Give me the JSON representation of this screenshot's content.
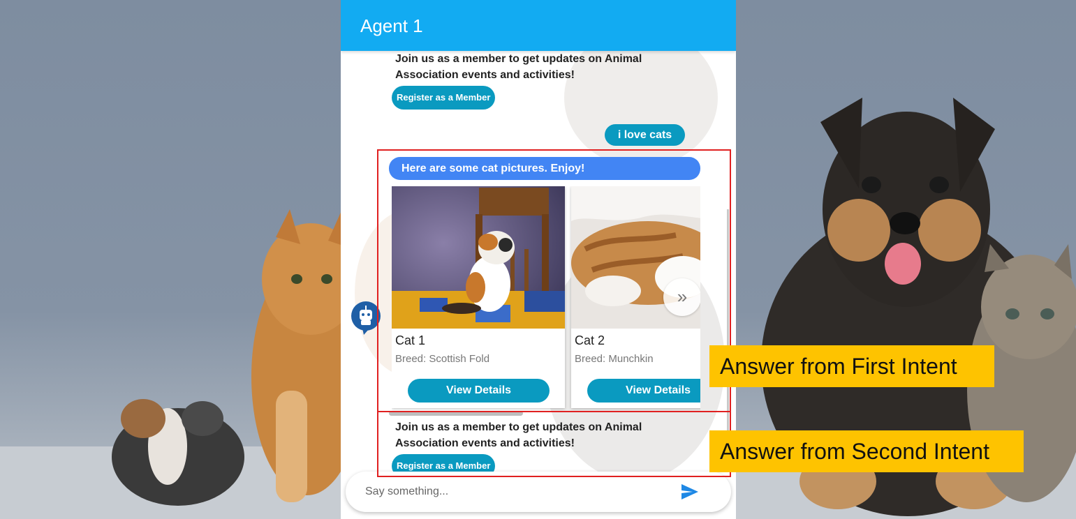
{
  "header": {
    "title": "Agent 1"
  },
  "messages": {
    "membership_1": {
      "text": "Join us as a member to get updates on Animal Association events and activities!",
      "button_label": "Register as a Member"
    },
    "user_message": "i love cats",
    "bot_reply": "Here are some cat pictures. Enjoy!",
    "cards": [
      {
        "title": "Cat 1",
        "subtitle": "Breed: Scottish Fold",
        "button_label": "View Details"
      },
      {
        "title": "Cat 2",
        "subtitle": "Breed: Munchkin",
        "button_label": "View Details"
      }
    ],
    "next_arrow": "»",
    "membership_2": {
      "text": "Join us as a member to get updates on Animal Association events and activities!",
      "button_label": "Register as a Member"
    }
  },
  "input": {
    "placeholder": "Say something..."
  },
  "annotations": {
    "first_intent": "Answer from First Intent",
    "second_intent": "Answer from Second Intent"
  },
  "colors": {
    "header": "#12abf2",
    "button": "#0a9ac0",
    "bot_bubble": "#4285f4",
    "annotation_box": "#e02020",
    "annotation_label": "#fec300",
    "send_icon": "#1e88e5"
  },
  "icons": [
    "robot-avatar-icon",
    "send-icon",
    "chevron-right-double-icon"
  ]
}
